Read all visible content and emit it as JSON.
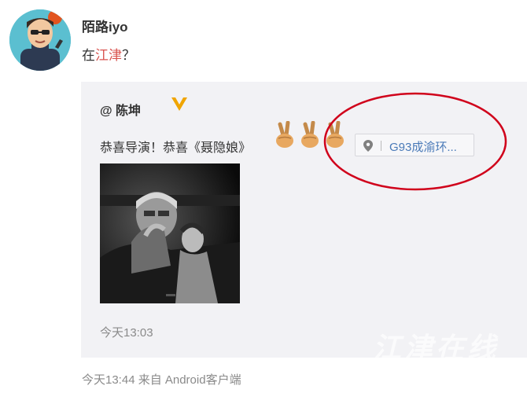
{
  "user": {
    "name": "陌路iyo"
  },
  "post": {
    "prefix": "在",
    "link": "江津",
    "suffix": "？"
  },
  "repost": {
    "author": "@ 陈坤",
    "text": "恭喜导演！恭喜《聂隐娘》",
    "location": "G93成渝环...",
    "time": "今天13:03"
  },
  "footer": "今天13:44 来自 Android客户端",
  "watermark": "江津在线",
  "colors": {
    "link": "#d9534f",
    "location_text": "#4a7ab8",
    "vip_badge": "#f0a500",
    "annotation": "#d0021b"
  },
  "icons": [
    "avatar",
    "vip-badge-icon",
    "victory-hand-icon",
    "location-pin-icon"
  ]
}
